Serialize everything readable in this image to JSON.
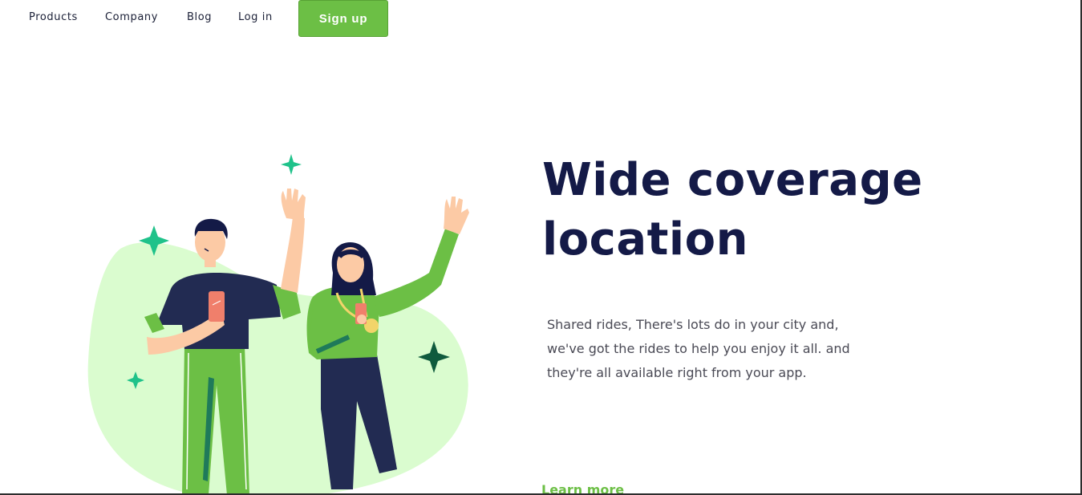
{
  "nav": {
    "links": [
      "Products",
      "Company",
      "Blog",
      "Log in"
    ],
    "signup_label": "Sign up"
  },
  "hero": {
    "headline_line1": "Wide coverage",
    "headline_line2": "location",
    "desc_line1": "Shared rides, There's lots do in your city and,",
    "desc_line2": "we've got the rides to help you enjoy it all. and",
    "desc_line3": "they're all available right from your app.",
    "learn_more": "Learn more"
  },
  "colors": {
    "accent": "#6cbf45",
    "heading": "#141a47",
    "blob": "#dafccf",
    "sparkle_teal": "#1fc28a",
    "sparkle_dark": "#0f5a3d"
  },
  "icons": [
    "sparkle-icon",
    "people-illustration"
  ]
}
